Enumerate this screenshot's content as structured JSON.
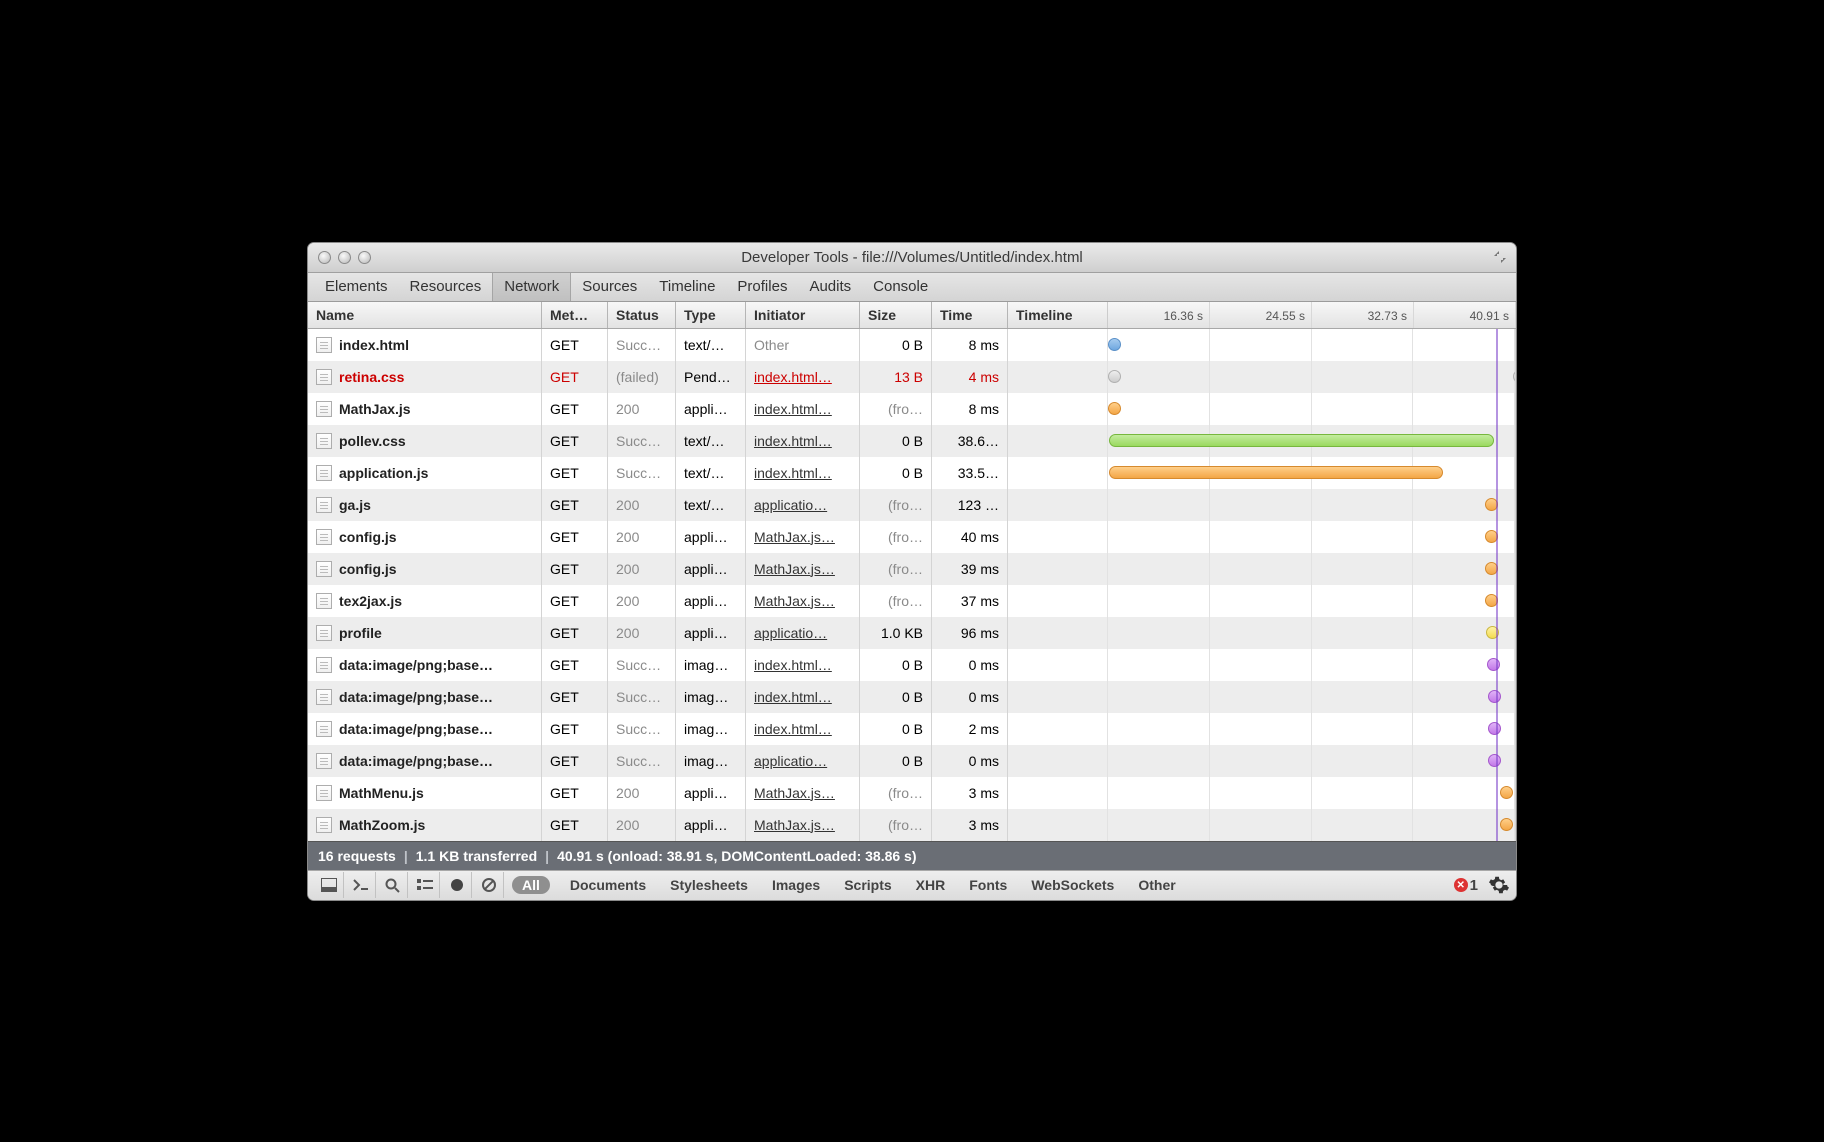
{
  "window": {
    "title": "Developer Tools - file:///Volumes/Untitled/index.html"
  },
  "tabs": [
    "Elements",
    "Resources",
    "Network",
    "Sources",
    "Timeline",
    "Profiles",
    "Audits",
    "Console"
  ],
  "active_tab": "Network",
  "columns": {
    "name": "Name",
    "method": "Met…",
    "status": "Status",
    "type": "Type",
    "initiator": "Initiator",
    "size": "Size",
    "time": "Time",
    "timeline": "Timeline"
  },
  "timeline_ticks": [
    "16.36 s",
    "24.55 s",
    "32.73 s",
    "40.91 s"
  ],
  "timeline_max_s": 40.91,
  "load_line_s": 38.9,
  "rows": [
    {
      "name": "index.html",
      "method": "GET",
      "status": "Succ…",
      "status_muted": true,
      "type": "text/…",
      "initiator": "Other",
      "initiator_link": false,
      "size": "0 B",
      "time": "8 ms",
      "bar": {
        "start_s": 0,
        "dur_s": 0.4,
        "color": "blue"
      }
    },
    {
      "name": "retina.css",
      "method": "GET",
      "status": "(failed)",
      "status_muted": true,
      "type": "Pend…",
      "initiator": "index.html…",
      "initiator_link": true,
      "size": "13 B",
      "time": "4 ms",
      "failed": true,
      "bar": {
        "start_s": 0,
        "dur_s": 0.4,
        "color": "grey"
      },
      "tail": {
        "at_s": 40.6,
        "color": "grey"
      }
    },
    {
      "name": "MathJax.js",
      "method": "GET",
      "status": "200",
      "status_muted": true,
      "type": "appli…",
      "initiator": "index.html…",
      "initiator_link": true,
      "size": "(fro…",
      "size_muted": true,
      "time": "8 ms",
      "bar": {
        "start_s": 0,
        "dur_s": 0.4,
        "color": "orange"
      }
    },
    {
      "name": "pollev.css",
      "method": "GET",
      "status": "Succ…",
      "status_muted": true,
      "type": "text/…",
      "initiator": "index.html…",
      "initiator_link": true,
      "size": "0 B",
      "time": "38.6…",
      "bar": {
        "start_s": 0.1,
        "dur_s": 38.6,
        "color": "green"
      }
    },
    {
      "name": "application.js",
      "method": "GET",
      "status": "Succ…",
      "status_muted": true,
      "type": "text/…",
      "initiator": "index.html…",
      "initiator_link": true,
      "size": "0 B",
      "time": "33.5…",
      "bar": {
        "start_s": 0.1,
        "dur_s": 33.5,
        "color": "orange"
      }
    },
    {
      "name": "ga.js",
      "method": "GET",
      "status": "200",
      "status_muted": true,
      "type": "text/…",
      "initiator": "applicatio…",
      "initiator_link": true,
      "size": "(fro…",
      "size_muted": true,
      "time": "123 …",
      "bar": {
        "start_s": 37.8,
        "dur_s": 0.4,
        "color": "orange"
      }
    },
    {
      "name": "config.js",
      "method": "GET",
      "status": "200",
      "status_muted": true,
      "type": "appli…",
      "initiator": "MathJax.js…",
      "initiator_link": true,
      "size": "(fro…",
      "size_muted": true,
      "time": "40 ms",
      "bar": {
        "start_s": 37.8,
        "dur_s": 0.4,
        "color": "orange"
      }
    },
    {
      "name": "config.js",
      "method": "GET",
      "status": "200",
      "status_muted": true,
      "type": "appli…",
      "initiator": "MathJax.js…",
      "initiator_link": true,
      "size": "(fro…",
      "size_muted": true,
      "time": "39 ms",
      "bar": {
        "start_s": 37.8,
        "dur_s": 0.4,
        "color": "orange"
      }
    },
    {
      "name": "tex2jax.js",
      "method": "GET",
      "status": "200",
      "status_muted": true,
      "type": "appli…",
      "initiator": "MathJax.js…",
      "initiator_link": true,
      "size": "(fro…",
      "size_muted": true,
      "time": "37 ms",
      "bar": {
        "start_s": 37.8,
        "dur_s": 0.4,
        "color": "orange"
      }
    },
    {
      "name": "profile",
      "method": "GET",
      "status": "200",
      "status_muted": true,
      "type": "appli…",
      "initiator": "applicatio…",
      "initiator_link": true,
      "size": "1.0 KB",
      "time": "96 ms",
      "bar": {
        "start_s": 37.9,
        "dur_s": 0.4,
        "color": "yellow"
      }
    },
    {
      "name": "data:image/png;base…",
      "method": "GET",
      "status": "Succ…",
      "status_muted": true,
      "type": "imag…",
      "initiator": "index.html…",
      "initiator_link": true,
      "size": "0 B",
      "time": "0 ms",
      "bar": {
        "start_s": 38.0,
        "dur_s": 0.4,
        "color": "purple"
      }
    },
    {
      "name": "data:image/png;base…",
      "method": "GET",
      "status": "Succ…",
      "status_muted": true,
      "type": "imag…",
      "initiator": "index.html…",
      "initiator_link": true,
      "size": "0 B",
      "time": "0 ms",
      "bar": {
        "start_s": 38.1,
        "dur_s": 0.4,
        "color": "purple"
      }
    },
    {
      "name": "data:image/png;base…",
      "method": "GET",
      "status": "Succ…",
      "status_muted": true,
      "type": "imag…",
      "initiator": "index.html…",
      "initiator_link": true,
      "size": "0 B",
      "time": "2 ms",
      "bar": {
        "start_s": 38.1,
        "dur_s": 0.4,
        "color": "purple"
      }
    },
    {
      "name": "data:image/png;base…",
      "method": "GET",
      "status": "Succ…",
      "status_muted": true,
      "type": "imag…",
      "initiator": "applicatio…",
      "initiator_link": true,
      "size": "0 B",
      "time": "0 ms",
      "bar": {
        "start_s": 38.1,
        "dur_s": 0.4,
        "color": "purple"
      }
    },
    {
      "name": "MathMenu.js",
      "method": "GET",
      "status": "200",
      "status_muted": true,
      "type": "appli…",
      "initiator": "MathJax.js…",
      "initiator_link": true,
      "size": "(fro…",
      "size_muted": true,
      "time": "3 ms",
      "bar": {
        "start_s": 39.3,
        "dur_s": 0.4,
        "color": "orange"
      }
    },
    {
      "name": "MathZoom.js",
      "method": "GET",
      "status": "200",
      "status_muted": true,
      "type": "appli…",
      "initiator": "MathJax.js…",
      "initiator_link": true,
      "size": "(fro…",
      "size_muted": true,
      "time": "3 ms",
      "bar": {
        "start_s": 39.3,
        "dur_s": 0.4,
        "color": "orange"
      }
    }
  ],
  "summary": {
    "requests": "16 requests",
    "transferred": "1.1 KB transferred",
    "timing": "40.91 s (onload: 38.91 s, DOMContentLoaded: 38.86 s)"
  },
  "filters": {
    "all": "All",
    "items": [
      "Documents",
      "Stylesheets",
      "Images",
      "Scripts",
      "XHR",
      "Fonts",
      "WebSockets",
      "Other"
    ]
  },
  "error_count": "1"
}
